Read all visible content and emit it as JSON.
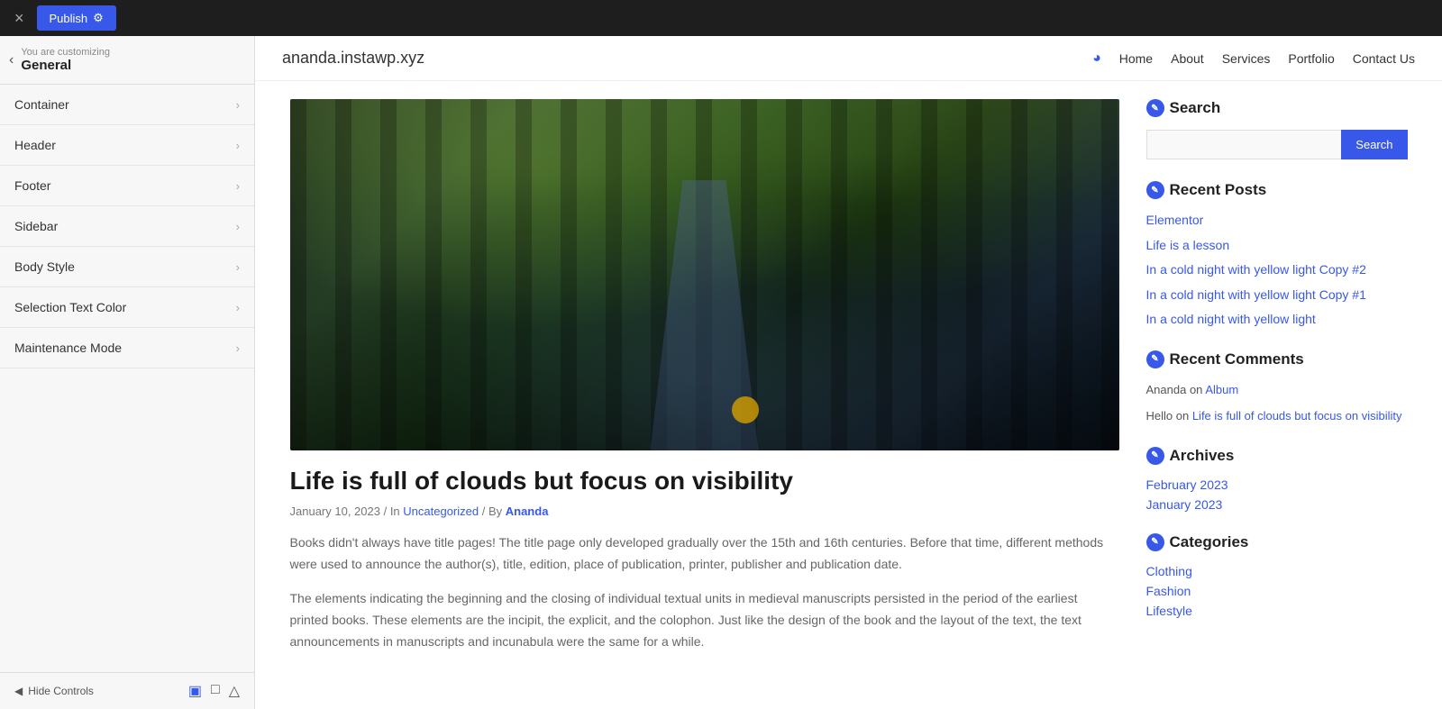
{
  "topbar": {
    "close_icon": "×",
    "publish_label": "Publish",
    "gear_icon": "⚙"
  },
  "sidebar": {
    "customizing_label": "You are customizing",
    "section_title": "General",
    "items": [
      {
        "label": "Container"
      },
      {
        "label": "Header"
      },
      {
        "label": "Footer"
      },
      {
        "label": "Sidebar"
      },
      {
        "label": "Body Style"
      },
      {
        "label": "Selection Text Color"
      },
      {
        "label": "Maintenance Mode"
      }
    ],
    "hide_controls_label": "Hide Controls"
  },
  "website": {
    "logo": "ananda.instawp.xyz",
    "nav": [
      {
        "label": "Home"
      },
      {
        "label": "About"
      },
      {
        "label": "Services"
      },
      {
        "label": "Portfolio"
      },
      {
        "label": "Contact Us"
      }
    ]
  },
  "post": {
    "title": "Life is full of clouds but focus on visibility",
    "date": "January 10, 2023",
    "category": "Uncategorized",
    "author": "Ananda",
    "excerpt1": "Books didn't always have title pages! The title page only developed gradually over the 15th and 16th centuries. Before that time, different methods were used to announce the author(s), title, edition, place of publication, printer, publisher and publication date.",
    "excerpt2": "The elements indicating the beginning and the closing of individual textual units in medieval manuscripts persisted in the period of the earliest printed books. These elements are the incipit, the explicit, and the colophon. Just like the design of the book and the layout of the text, the text announcements in manuscripts and incunabula were the same for a while."
  },
  "widgets": {
    "search": {
      "title": "Search",
      "input_placeholder": "",
      "button_label": "Search"
    },
    "recent_posts": {
      "title": "Recent Posts",
      "posts": [
        {
          "label": "Elementor"
        },
        {
          "label": "Life is a lesson"
        },
        {
          "label": "In a cold night with yellow light Copy #2"
        },
        {
          "label": "In a cold night with yellow light Copy #1"
        },
        {
          "label": "In a cold night with yellow light"
        }
      ]
    },
    "recent_comments": {
      "title": "Recent Comments",
      "comments": [
        {
          "author": "Ananda",
          "preposition": "on",
          "link_label": "Album"
        },
        {
          "author": "Hello",
          "preposition": "on",
          "link_label": "Life is full of clouds but focus on visibility"
        }
      ]
    },
    "archives": {
      "title": "Archives",
      "items": [
        {
          "label": "February 2023"
        },
        {
          "label": "January 2023"
        }
      ]
    },
    "categories": {
      "title": "Categories",
      "items": [
        {
          "label": "Clothing"
        },
        {
          "label": "Fashion"
        },
        {
          "label": "Lifestyle"
        }
      ]
    }
  }
}
